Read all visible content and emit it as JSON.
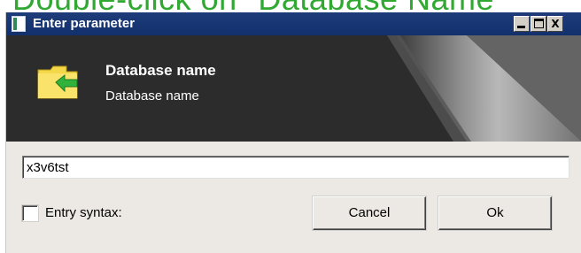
{
  "overlay_caption": "Double-click on \"Database Name\"",
  "window": {
    "title": "Enter parameter",
    "controls": {
      "minimize_icon": "minimize-icon",
      "maximize_icon": "maximize-icon",
      "close_label": "X"
    }
  },
  "header": {
    "icon": "folder-arrow-icon",
    "title": "Database name",
    "subtitle": "Database name"
  },
  "input": {
    "value": "x3v6tst"
  },
  "entry_syntax": {
    "label": "Entry syntax:",
    "checked": false
  },
  "buttons": {
    "cancel_label": "Cancel",
    "ok_label": "Ok"
  },
  "colors": {
    "titlebar": "#12306c",
    "banner": "#2c2c2c",
    "caption": "#31a832",
    "folder": "#f5d84a",
    "arrow": "#2fb33a"
  }
}
